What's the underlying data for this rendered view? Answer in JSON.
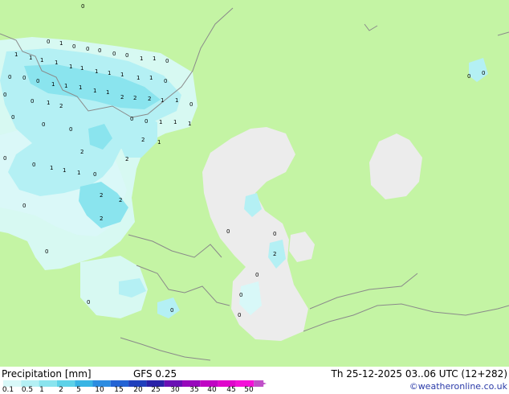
{
  "title": "Precipitation [mm]",
  "model": "GFS 0.25",
  "validity": "Th 25-12-2025 03..06 UTC (12+282)",
  "credit": "©weatheronline.co.uk",
  "legend": {
    "colors": [
      "#d8f8f8",
      "#b4f0f4",
      "#8ae4ee",
      "#5ed2e8",
      "#38b4e4",
      "#2c8ce0",
      "#2464d4",
      "#2040bc",
      "#2a22a8",
      "#6a10b4",
      "#9808bc",
      "#c004c4",
      "#e006cc",
      "#f410d8",
      "#c050c8"
    ],
    "ticks": [
      "0.1",
      "0.5",
      "1",
      "2",
      "5",
      "10",
      "15",
      "20",
      "25",
      "30",
      "35",
      "40",
      "45",
      "50"
    ]
  },
  "map_labels": {
    "west_zero": [
      "0",
      "0",
      "0",
      "0",
      "0",
      "0",
      "0",
      "0",
      "0",
      "0",
      "0",
      "0",
      "0",
      "0",
      "0",
      "0",
      "0",
      "0",
      "0",
      "0",
      "0",
      "0",
      "0",
      "0",
      "0",
      "0",
      "0"
    ],
    "west_one": [
      "1",
      "1",
      "1",
      "1",
      "1",
      "1",
      "1",
      "1",
      "1",
      "1",
      "1",
      "1",
      "1",
      "1",
      "1",
      "1",
      "1",
      "1",
      "1",
      "1",
      "1",
      "1",
      "1",
      "1",
      "1",
      "1",
      "1",
      "1",
      "1"
    ],
    "west_two": [
      "2",
      "2",
      "2",
      "2",
      "2",
      "2",
      "2",
      "2",
      "2",
      "2"
    ],
    "caspian": [
      "0",
      "0",
      "0",
      "2",
      "0",
      "0"
    ],
    "east_zero": [
      "0",
      "0"
    ]
  },
  "colors": {
    "land": "#c4f4a4",
    "water": "#ececec",
    "precip_light": "#d8f8f8",
    "precip_mid": "#b4f0f4",
    "precip_strong": "#8ae4ee",
    "border": "#8a8a8a"
  }
}
